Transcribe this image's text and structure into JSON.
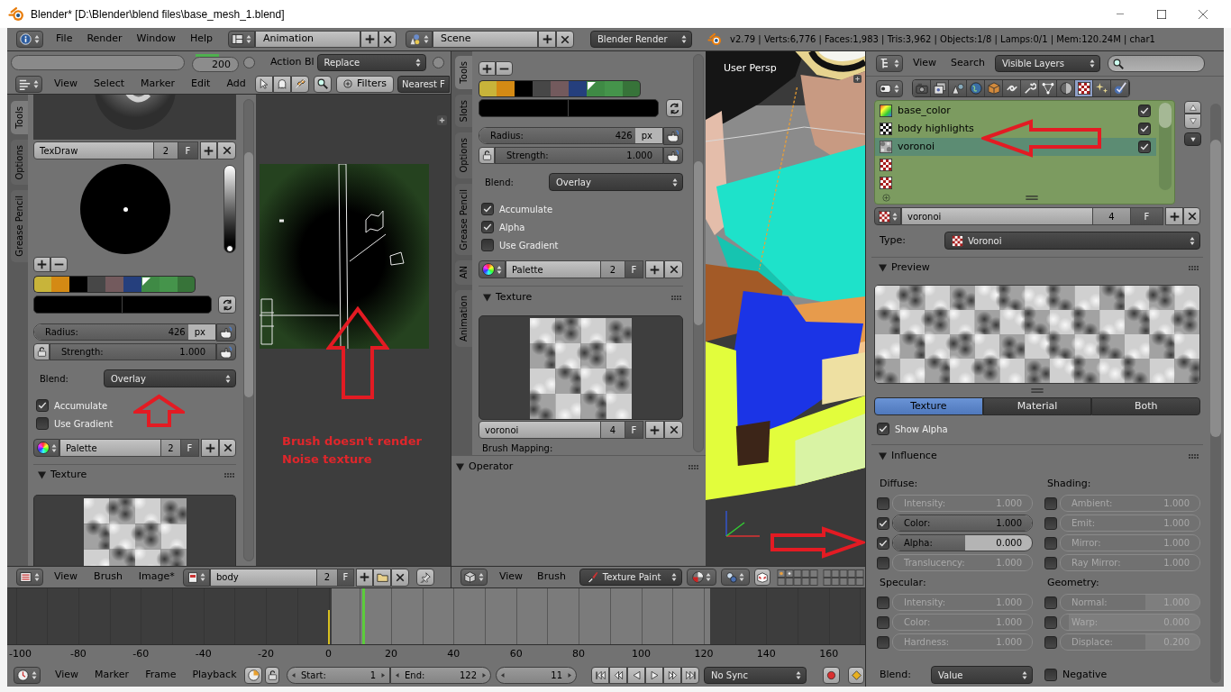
{
  "window": {
    "title": "Blender* [D:\\Blender\\blend files\\base_mesh_1.blend]"
  },
  "info_header": {
    "menus": [
      "File",
      "Render",
      "Window",
      "Help"
    ],
    "screen_layout": "Animation",
    "scene": "Scene",
    "render_engine": "Blender Render",
    "stats": "v2.79 | Verts:6,776 | Faces:1,983 | Tris:3,962 | Objects:1/8 | Lamps:0/1 | Mem:120.24M | char1"
  },
  "action_strip": {
    "frame": "200",
    "label": "Action Bl",
    "blend_mode": "Replace"
  },
  "dopesheet_header": {
    "menus": [
      "View",
      "Select",
      "Marker",
      "Edit",
      "Add"
    ],
    "filters": "Filters",
    "snap": "Nearest F"
  },
  "image_tool_shelf": {
    "tabs": [
      {
        "label": "Tools",
        "selected": true
      },
      {
        "label": "Options",
        "selected": false
      },
      {
        "label": "Grease Pencil",
        "selected": false
      }
    ],
    "brush": {
      "name": "TexDraw",
      "users": "2",
      "fake_user": "F"
    },
    "value_slider": {
      "level": 0
    },
    "palette_colors": [
      {
        "color": "#c8b43a",
        "selected": false
      },
      {
        "color": "#d48a14",
        "selected": false
      },
      {
        "color": "#000000",
        "selected": false
      },
      {
        "color": "#474747",
        "selected": false
      },
      {
        "color": "#735a5d",
        "selected": false
      },
      {
        "color": "#253f7d",
        "selected": false
      },
      {
        "color": "#3f8a45",
        "selected": true
      },
      {
        "color": "#45944b",
        "selected": false
      },
      {
        "color": "#377339",
        "selected": false
      }
    ],
    "radius": {
      "label": "Radius:",
      "value": "426",
      "unit": "px",
      "level": 0.85
    },
    "strength": {
      "label": "Strength:",
      "value": "1.000",
      "level": 1
    },
    "blend": {
      "label": "Blend:",
      "value": "Overlay"
    },
    "options": [
      {
        "label": "Accumulate",
        "checked": true
      },
      {
        "label": "Use Gradient",
        "checked": false
      }
    ],
    "palette": {
      "name": "Palette",
      "users": "2",
      "fake_user": "F"
    },
    "texture_panel": {
      "title": "Texture"
    }
  },
  "image_canvas": {
    "annotation": [
      "Brush doesn't render",
      "Noise texture"
    ]
  },
  "image_header": {
    "menus": [
      "View",
      "Brush",
      "Image*"
    ],
    "image": {
      "name": "body",
      "users": "2",
      "fake_user": "F"
    }
  },
  "view3d_tool_shelf": {
    "tabs": [
      {
        "label": "Tools",
        "selected": true
      },
      {
        "label": "Slots",
        "selected": false
      },
      {
        "label": "Options",
        "selected": false
      },
      {
        "label": "Grease Pencil",
        "selected": false
      },
      {
        "label": "AN",
        "selected": false
      },
      {
        "label": "Animation",
        "selected": false
      }
    ],
    "palette_colors": [
      {
        "color": "#c8b43a",
        "selected": false
      },
      {
        "color": "#d48a14",
        "selected": false
      },
      {
        "color": "#000000",
        "selected": false
      },
      {
        "color": "#474747",
        "selected": false
      },
      {
        "color": "#735a5d",
        "selected": false
      },
      {
        "color": "#253f7d",
        "selected": false
      },
      {
        "color": "#3f8a45",
        "selected": true
      },
      {
        "color": "#45944b",
        "selected": false
      },
      {
        "color": "#377339",
        "selected": false
      }
    ],
    "radius": {
      "label": "Radius:",
      "value": "426",
      "unit": "px",
      "level": 0.85
    },
    "strength": {
      "label": "Strength:",
      "value": "1.000",
      "level": 1
    },
    "blend": {
      "label": "Blend:",
      "value": "Overlay"
    },
    "options": [
      {
        "label": "Accumulate",
        "checked": true
      },
      {
        "label": "Alpha",
        "checked": true
      },
      {
        "label": "Use Gradient",
        "checked": false
      }
    ],
    "palette": {
      "name": "Palette",
      "users": "2",
      "fake_user": "F"
    },
    "texture_panel": {
      "title": "Texture",
      "texture": {
        "name": "voronoi",
        "users": "4",
        "fake_user": "F"
      },
      "mapping_label": "Brush Mapping:"
    },
    "operator_panel": {
      "title": "Operator"
    }
  },
  "viewport": {
    "label": "User Persp"
  },
  "view3d_header": {
    "menus": [
      "View",
      "Brush"
    ],
    "mode": "Texture Paint"
  },
  "timeline": {
    "ticks": [
      "-100",
      "-80",
      "-60",
      "-40",
      "-20",
      "0",
      "20",
      "40",
      "60",
      "80",
      "100",
      "120",
      "140",
      "160"
    ]
  },
  "timeline_header": {
    "menus": [
      "View",
      "Marker",
      "Frame",
      "Playback"
    ],
    "start": {
      "label": "Start:",
      "value": "1"
    },
    "end": {
      "label": "End:",
      "value": "122"
    },
    "current_frame": "11",
    "sync": "No Sync"
  },
  "outliner_header": {
    "menus": [
      "View",
      "Search"
    ],
    "filter": "Visible Layers"
  },
  "properties": {
    "tabs": [
      {
        "kind": "render",
        "selected": false
      },
      {
        "kind": "render_layers",
        "selected": false
      },
      {
        "kind": "scene",
        "selected": false
      },
      {
        "kind": "world",
        "selected": false
      },
      {
        "kind": "object",
        "selected": false
      },
      {
        "kind": "constraints",
        "selected": false
      },
      {
        "kind": "modifiers",
        "selected": false
      },
      {
        "kind": "data",
        "selected": false
      },
      {
        "kind": "material",
        "selected": false
      },
      {
        "kind": "texture",
        "selected": true
      },
      {
        "kind": "particles",
        "selected": false
      },
      {
        "kind": "physics",
        "selected": false
      }
    ],
    "texture_slots": [
      {
        "kind": "gradient",
        "name": "base_color",
        "checked": true,
        "selected": false
      },
      {
        "kind": "checker",
        "name": "body highlights",
        "checked": true,
        "selected": false
      },
      {
        "kind": "noise",
        "name": "voronoi",
        "checked": true,
        "selected": true
      },
      {
        "kind": "empty",
        "selected": false
      },
      {
        "kind": "empty",
        "selected": false
      }
    ],
    "texture": {
      "name": "voronoi",
      "users": "4",
      "fake_user": "F"
    },
    "type": {
      "label": "Type:",
      "value": "Voronoi"
    },
    "preview_panel": {
      "title": "Preview",
      "tabs": [
        {
          "label": "Texture",
          "selected": true
        },
        {
          "label": "Material",
          "selected": false
        },
        {
          "label": "Both",
          "selected": false
        }
      ],
      "show_alpha": {
        "label": "Show Alpha",
        "checked": true
      }
    },
    "influence_panel": {
      "title": "Influence",
      "columns": [
        {
          "groups": [
            {
              "title": "Diffuse:",
              "items": [
                {
                  "label": "Intensity:",
                  "value": "1.000",
                  "checked": false,
                  "level": 1
                },
                {
                  "label": "Color:",
                  "value": "1.000",
                  "checked": true,
                  "level": 1
                },
                {
                  "label": "Alpha:",
                  "value": "0.000",
                  "checked": true,
                  "level": 0.52
                },
                {
                  "label": "Translucency:",
                  "value": "1.000",
                  "checked": false,
                  "level": 1
                }
              ]
            },
            {
              "title": "Specular:",
              "items": [
                {
                  "label": "Intensity:",
                  "value": "1.000",
                  "checked": false,
                  "level": 1
                },
                {
                  "label": "Color:",
                  "value": "1.000",
                  "checked": false,
                  "level": 1
                },
                {
                  "label": "Hardness:",
                  "value": "1.000",
                  "checked": false,
                  "level": 1
                }
              ]
            }
          ]
        },
        {
          "groups": [
            {
              "title": "Shading:",
              "items": [
                {
                  "label": "Ambient:",
                  "value": "1.000",
                  "checked": false,
                  "level": 1
                },
                {
                  "label": "Emit:",
                  "value": "1.000",
                  "checked": false,
                  "level": 1
                },
                {
                  "label": "Mirror:",
                  "value": "1.000",
                  "checked": false,
                  "level": 1
                },
                {
                  "label": "Ray Mirror:",
                  "value": "1.000",
                  "checked": false,
                  "level": 1
                }
              ]
            },
            {
              "title": "Geometry:",
              "items": [
                {
                  "label": "Normal:",
                  "value": "1.000",
                  "checked": false,
                  "level": 0.61
                },
                {
                  "label": "Warp:",
                  "value": "0.000",
                  "checked": false,
                  "level": 0.06
                },
                {
                  "label": "Displace:",
                  "value": "0.200",
                  "checked": false,
                  "level": 0.61
                }
              ]
            }
          ]
        }
      ],
      "blend": {
        "label": "Blend:",
        "value": "Value"
      },
      "negative": {
        "label": "Negative",
        "checked": false
      }
    }
  }
}
